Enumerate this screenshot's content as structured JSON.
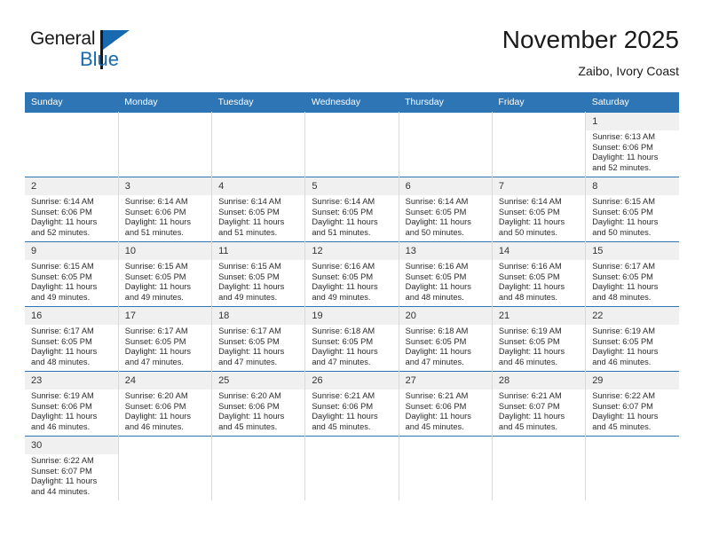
{
  "brand": {
    "name_top": "General",
    "name_bottom": "Blue",
    "flag_color": "#1769b0"
  },
  "header": {
    "month_title": "November 2025",
    "location": "Zaibo, Ivory Coast"
  },
  "theme": {
    "header_blue": "#2e75b6",
    "daynum_bg": "#f0f0f0",
    "text": "#222222"
  },
  "weekdays": [
    "Sunday",
    "Monday",
    "Tuesday",
    "Wednesday",
    "Thursday",
    "Friday",
    "Saturday"
  ],
  "weeks": [
    [
      {
        "day": "",
        "sunrise": "",
        "sunset": "",
        "daylight": ""
      },
      {
        "day": "",
        "sunrise": "",
        "sunset": "",
        "daylight": ""
      },
      {
        "day": "",
        "sunrise": "",
        "sunset": "",
        "daylight": ""
      },
      {
        "day": "",
        "sunrise": "",
        "sunset": "",
        "daylight": ""
      },
      {
        "day": "",
        "sunrise": "",
        "sunset": "",
        "daylight": ""
      },
      {
        "day": "",
        "sunrise": "",
        "sunset": "",
        "daylight": ""
      },
      {
        "day": "1",
        "sunrise": "Sunrise: 6:13 AM",
        "sunset": "Sunset: 6:06 PM",
        "daylight": "Daylight: 11 hours and 52 minutes."
      }
    ],
    [
      {
        "day": "2",
        "sunrise": "Sunrise: 6:14 AM",
        "sunset": "Sunset: 6:06 PM",
        "daylight": "Daylight: 11 hours and 52 minutes."
      },
      {
        "day": "3",
        "sunrise": "Sunrise: 6:14 AM",
        "sunset": "Sunset: 6:06 PM",
        "daylight": "Daylight: 11 hours and 51 minutes."
      },
      {
        "day": "4",
        "sunrise": "Sunrise: 6:14 AM",
        "sunset": "Sunset: 6:05 PM",
        "daylight": "Daylight: 11 hours and 51 minutes."
      },
      {
        "day": "5",
        "sunrise": "Sunrise: 6:14 AM",
        "sunset": "Sunset: 6:05 PM",
        "daylight": "Daylight: 11 hours and 51 minutes."
      },
      {
        "day": "6",
        "sunrise": "Sunrise: 6:14 AM",
        "sunset": "Sunset: 6:05 PM",
        "daylight": "Daylight: 11 hours and 50 minutes."
      },
      {
        "day": "7",
        "sunrise": "Sunrise: 6:14 AM",
        "sunset": "Sunset: 6:05 PM",
        "daylight": "Daylight: 11 hours and 50 minutes."
      },
      {
        "day": "8",
        "sunrise": "Sunrise: 6:15 AM",
        "sunset": "Sunset: 6:05 PM",
        "daylight": "Daylight: 11 hours and 50 minutes."
      }
    ],
    [
      {
        "day": "9",
        "sunrise": "Sunrise: 6:15 AM",
        "sunset": "Sunset: 6:05 PM",
        "daylight": "Daylight: 11 hours and 49 minutes."
      },
      {
        "day": "10",
        "sunrise": "Sunrise: 6:15 AM",
        "sunset": "Sunset: 6:05 PM",
        "daylight": "Daylight: 11 hours and 49 minutes."
      },
      {
        "day": "11",
        "sunrise": "Sunrise: 6:15 AM",
        "sunset": "Sunset: 6:05 PM",
        "daylight": "Daylight: 11 hours and 49 minutes."
      },
      {
        "day": "12",
        "sunrise": "Sunrise: 6:16 AM",
        "sunset": "Sunset: 6:05 PM",
        "daylight": "Daylight: 11 hours and 49 minutes."
      },
      {
        "day": "13",
        "sunrise": "Sunrise: 6:16 AM",
        "sunset": "Sunset: 6:05 PM",
        "daylight": "Daylight: 11 hours and 48 minutes."
      },
      {
        "day": "14",
        "sunrise": "Sunrise: 6:16 AM",
        "sunset": "Sunset: 6:05 PM",
        "daylight": "Daylight: 11 hours and 48 minutes."
      },
      {
        "day": "15",
        "sunrise": "Sunrise: 6:17 AM",
        "sunset": "Sunset: 6:05 PM",
        "daylight": "Daylight: 11 hours and 48 minutes."
      }
    ],
    [
      {
        "day": "16",
        "sunrise": "Sunrise: 6:17 AM",
        "sunset": "Sunset: 6:05 PM",
        "daylight": "Daylight: 11 hours and 48 minutes."
      },
      {
        "day": "17",
        "sunrise": "Sunrise: 6:17 AM",
        "sunset": "Sunset: 6:05 PM",
        "daylight": "Daylight: 11 hours and 47 minutes."
      },
      {
        "day": "18",
        "sunrise": "Sunrise: 6:17 AM",
        "sunset": "Sunset: 6:05 PM",
        "daylight": "Daylight: 11 hours and 47 minutes."
      },
      {
        "day": "19",
        "sunrise": "Sunrise: 6:18 AM",
        "sunset": "Sunset: 6:05 PM",
        "daylight": "Daylight: 11 hours and 47 minutes."
      },
      {
        "day": "20",
        "sunrise": "Sunrise: 6:18 AM",
        "sunset": "Sunset: 6:05 PM",
        "daylight": "Daylight: 11 hours and 47 minutes."
      },
      {
        "day": "21",
        "sunrise": "Sunrise: 6:19 AM",
        "sunset": "Sunset: 6:05 PM",
        "daylight": "Daylight: 11 hours and 46 minutes."
      },
      {
        "day": "22",
        "sunrise": "Sunrise: 6:19 AM",
        "sunset": "Sunset: 6:05 PM",
        "daylight": "Daylight: 11 hours and 46 minutes."
      }
    ],
    [
      {
        "day": "23",
        "sunrise": "Sunrise: 6:19 AM",
        "sunset": "Sunset: 6:06 PM",
        "daylight": "Daylight: 11 hours and 46 minutes."
      },
      {
        "day": "24",
        "sunrise": "Sunrise: 6:20 AM",
        "sunset": "Sunset: 6:06 PM",
        "daylight": "Daylight: 11 hours and 46 minutes."
      },
      {
        "day": "25",
        "sunrise": "Sunrise: 6:20 AM",
        "sunset": "Sunset: 6:06 PM",
        "daylight": "Daylight: 11 hours and 45 minutes."
      },
      {
        "day": "26",
        "sunrise": "Sunrise: 6:21 AM",
        "sunset": "Sunset: 6:06 PM",
        "daylight": "Daylight: 11 hours and 45 minutes."
      },
      {
        "day": "27",
        "sunrise": "Sunrise: 6:21 AM",
        "sunset": "Sunset: 6:06 PM",
        "daylight": "Daylight: 11 hours and 45 minutes."
      },
      {
        "day": "28",
        "sunrise": "Sunrise: 6:21 AM",
        "sunset": "Sunset: 6:07 PM",
        "daylight": "Daylight: 11 hours and 45 minutes."
      },
      {
        "day": "29",
        "sunrise": "Sunrise: 6:22 AM",
        "sunset": "Sunset: 6:07 PM",
        "daylight": "Daylight: 11 hours and 45 minutes."
      }
    ],
    [
      {
        "day": "30",
        "sunrise": "Sunrise: 6:22 AM",
        "sunset": "Sunset: 6:07 PM",
        "daylight": "Daylight: 11 hours and 44 minutes."
      },
      {
        "day": "",
        "sunrise": "",
        "sunset": "",
        "daylight": ""
      },
      {
        "day": "",
        "sunrise": "",
        "sunset": "",
        "daylight": ""
      },
      {
        "day": "",
        "sunrise": "",
        "sunset": "",
        "daylight": ""
      },
      {
        "day": "",
        "sunrise": "",
        "sunset": "",
        "daylight": ""
      },
      {
        "day": "",
        "sunrise": "",
        "sunset": "",
        "daylight": ""
      },
      {
        "day": "",
        "sunrise": "",
        "sunset": "",
        "daylight": ""
      }
    ]
  ]
}
